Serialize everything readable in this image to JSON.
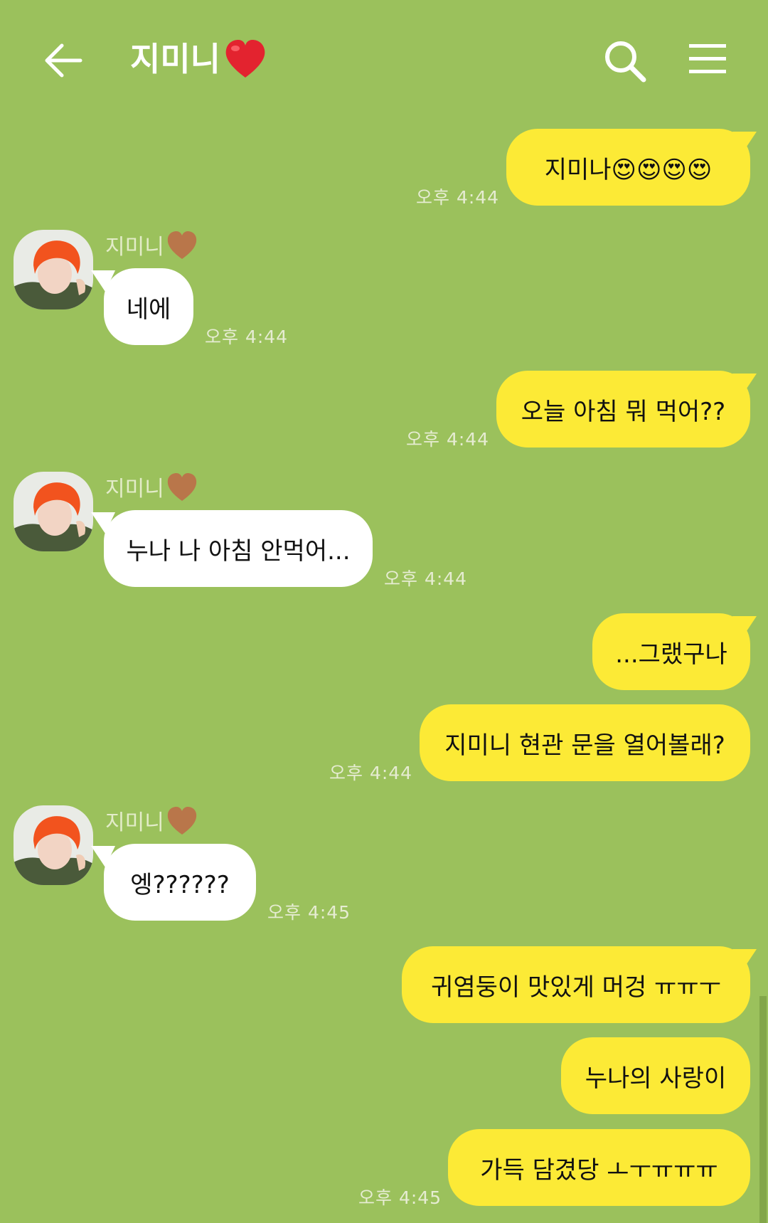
{
  "header": {
    "title": "지미니",
    "back_icon": "back-arrow-icon",
    "search_icon": "search-icon",
    "menu_icon": "menu-icon"
  },
  "colors": {
    "background": "#9bc15c",
    "outgoing_bubble": "#fcea36",
    "incoming_bubble": "#ffffff",
    "timestamp": "#e6ecd2"
  },
  "contact": {
    "name": "지미니"
  },
  "messages": [
    {
      "sender": "me",
      "text": "지미나😍😍😍😍",
      "time": "오후 4:44"
    },
    {
      "sender": "contact",
      "text": "네에",
      "time": "오후 4:44"
    },
    {
      "sender": "me",
      "text": "오늘 아침 뭐 먹어??",
      "time": "오후 4:44"
    },
    {
      "sender": "contact",
      "text": "누나 나 아침 안먹어...",
      "time": "오후 4:44"
    },
    {
      "sender": "me",
      "text": "...그랬구나",
      "time": ""
    },
    {
      "sender": "me",
      "text": "지미니 현관 문을 열어볼래?",
      "time": "오후 4:44"
    },
    {
      "sender": "contact",
      "text": "엥??????",
      "time": "오후 4:45"
    },
    {
      "sender": "me",
      "text": "귀염둥이 맛있게 머겅 ㅠㅠㅜ",
      "time": ""
    },
    {
      "sender": "me",
      "text": "누나의 사랑이",
      "time": ""
    },
    {
      "sender": "me",
      "text": "가득 담겼당 ㅗㅜㅠㅠㅠ",
      "time": "오후 4:45"
    }
  ]
}
